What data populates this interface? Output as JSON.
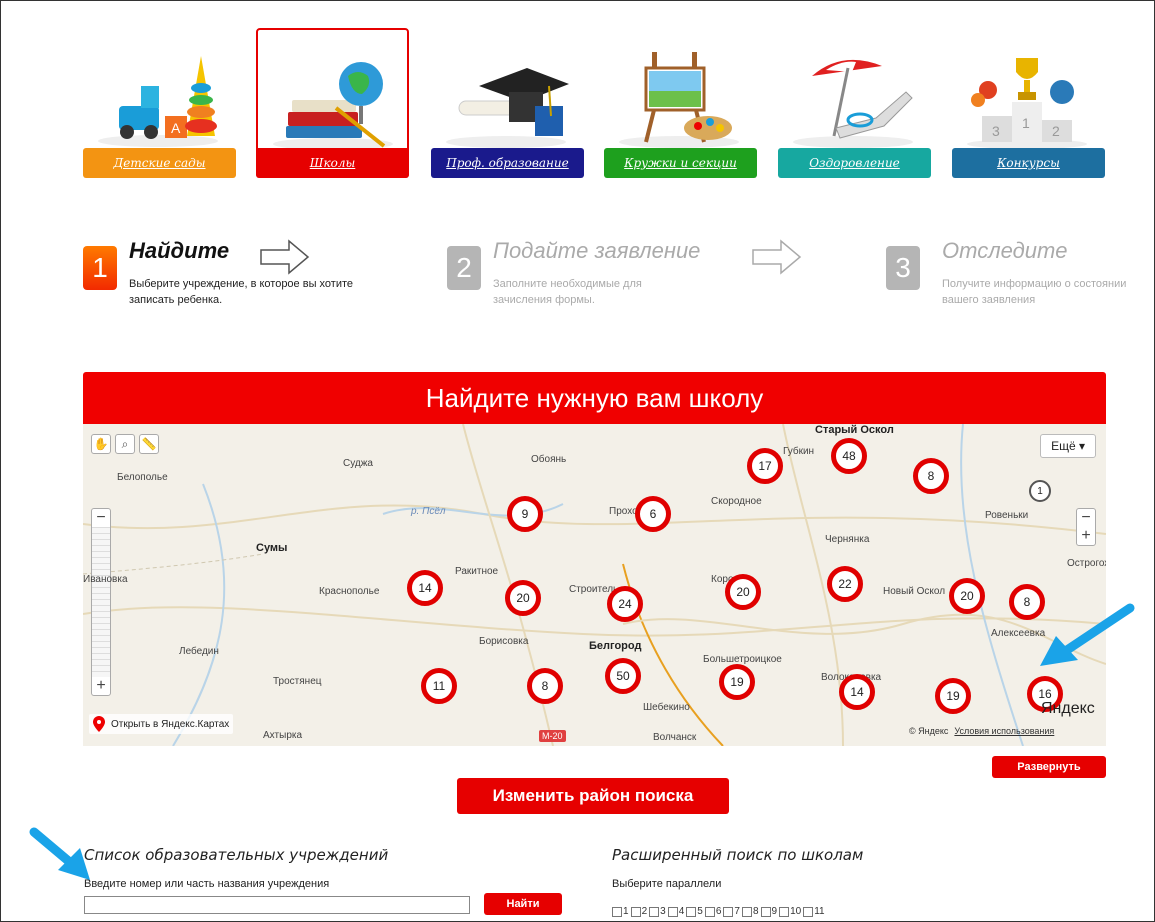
{
  "categories": [
    {
      "label": "Детские сады",
      "color": "#f39412",
      "icon": "toys-icon"
    },
    {
      "label": "Школы",
      "color": "#e60000",
      "icon": "books-globe-icon",
      "active": true
    },
    {
      "label": "Проф. образование",
      "color": "#1a1a8c",
      "icon": "graduation-cap-icon"
    },
    {
      "label": "Кружки и секции",
      "color": "#1ea01e",
      "icon": "easel-palette-icon"
    },
    {
      "label": "Оздоровление",
      "color": "#17a8a0",
      "icon": "beach-chair-icon"
    },
    {
      "label": "Конкурсы",
      "color": "#1d6fa0",
      "icon": "trophy-podium-icon"
    }
  ],
  "steps": [
    {
      "num": "1",
      "title": "Найдите",
      "desc": "Выберите учреждение, в которое вы хотите записать ребенка.",
      "color": "#ff5a00",
      "active": true
    },
    {
      "num": "2",
      "title": "Подайте заявление",
      "desc": "Заполните необходимые для зачисления формы.",
      "color": "#b5b5b5",
      "active": false
    },
    {
      "num": "3",
      "title": "Отследите",
      "desc": "Получите информацию о состоянии вашего заявления",
      "color": "#b5b5b5",
      "active": false
    }
  ],
  "banner_title": "Найдите нужную вам школу",
  "map": {
    "more_label": "Ещё ▾",
    "open_link": "Открыть в Яндекс.Картах",
    "copyright": "© Яндекс",
    "terms": "Условия использования",
    "logo": "Яндекс",
    "road_badge": "M-20",
    "places": [
      {
        "name": "Белополье",
        "big": false
      },
      {
        "name": "Суджа",
        "big": false
      },
      {
        "name": "Обоянь",
        "big": false
      },
      {
        "name": "Сумы",
        "big": true
      },
      {
        "name": "р. Псёл",
        "big": false
      },
      {
        "name": "Ракитное",
        "big": false
      },
      {
        "name": "Краснополье",
        "big": false
      },
      {
        "name": "Строитель",
        "big": false
      },
      {
        "name": "Лебедин",
        "big": false
      },
      {
        "name": "Борисовка",
        "big": false
      },
      {
        "name": "Белгород",
        "big": true
      },
      {
        "name": "Тростянец",
        "big": false
      },
      {
        "name": "Шебекино",
        "big": false
      },
      {
        "name": "Волчанск",
        "big": false
      },
      {
        "name": "Ахтырка",
        "big": false
      },
      {
        "name": "Скородное",
        "big": false
      },
      {
        "name": "Чернянка",
        "big": false
      },
      {
        "name": "Алексеевка",
        "big": false
      },
      {
        "name": "Ровеньки",
        "big": false
      },
      {
        "name": "Острогожск",
        "big": false
      },
      {
        "name": "Губкин",
        "big": false
      },
      {
        "name": "Старый Оскол",
        "big": true
      },
      {
        "name": "Новый Оскол",
        "big": false
      },
      {
        "name": "Прохоровка",
        "big": false
      },
      {
        "name": "Большетроицкое",
        "big": false
      },
      {
        "name": "Волоконовка",
        "big": false
      },
      {
        "name": "Корочa",
        "big": false
      },
      {
        "name": "Ивановка",
        "big": false
      }
    ],
    "clusters": [
      "48",
      "17",
      "8",
      "9",
      "6",
      "1",
      "14",
      "20",
      "24",
      "20",
      "22",
      "20",
      "8",
      "11",
      "8",
      "50",
      "19",
      "14",
      "19",
      "16"
    ]
  },
  "expand_label": "Развернуть",
  "change_area_label": "Изменить район поиска",
  "list": {
    "title": "Список образовательных учреждений",
    "hint": "Введите номер или часть названия учреждения",
    "input_value": "",
    "find_label": "Найти"
  },
  "advanced": {
    "title": "Расширенный поиск по школам",
    "hint": "Выберите параллели",
    "grades": [
      "1",
      "2",
      "3",
      "4",
      "5",
      "6",
      "7",
      "8",
      "9",
      "10",
      "11"
    ]
  },
  "annotation_color": "#1aa3e8"
}
